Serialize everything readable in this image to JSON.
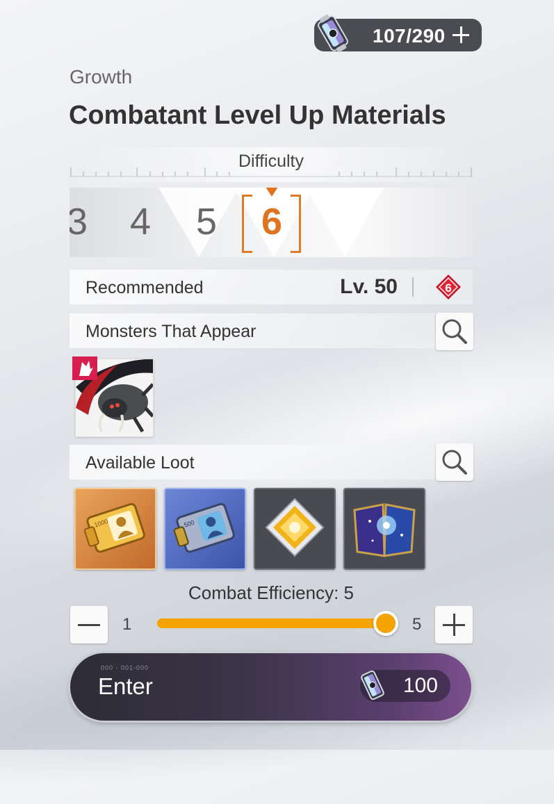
{
  "stamina": {
    "value": "107/290",
    "icon": "stamina-battery-icon"
  },
  "header": {
    "category": "Growth",
    "title": "Combatant Level Up Materials"
  },
  "difficulty": {
    "label": "Difficulty",
    "levels": [
      "3",
      "4",
      "5",
      "6"
    ],
    "selected": "6",
    "accent_color": "#e0741e"
  },
  "recommended": {
    "label": "Recommended",
    "level": "Lv. 50",
    "badge_icon": "difficulty-badge-icon"
  },
  "monsters": {
    "label": "Monsters That Appear",
    "items": [
      {
        "icon": "spider-monster-portrait"
      }
    ]
  },
  "loot": {
    "label": "Available Loot",
    "items": [
      {
        "icon": "gold-id-card-icon",
        "badge": "1000"
      },
      {
        "icon": "blue-id-card-icon",
        "badge": "500"
      },
      {
        "icon": "gold-crystal-icon"
      },
      {
        "icon": "galaxy-book-icon"
      }
    ]
  },
  "efficiency": {
    "label": "Combat Efficiency: 5",
    "min": "1",
    "max": "5",
    "value": 5,
    "fill_color": "#f5a300"
  },
  "enter": {
    "label": "Enter",
    "code": "000 - 001-000",
    "cost": "100"
  }
}
